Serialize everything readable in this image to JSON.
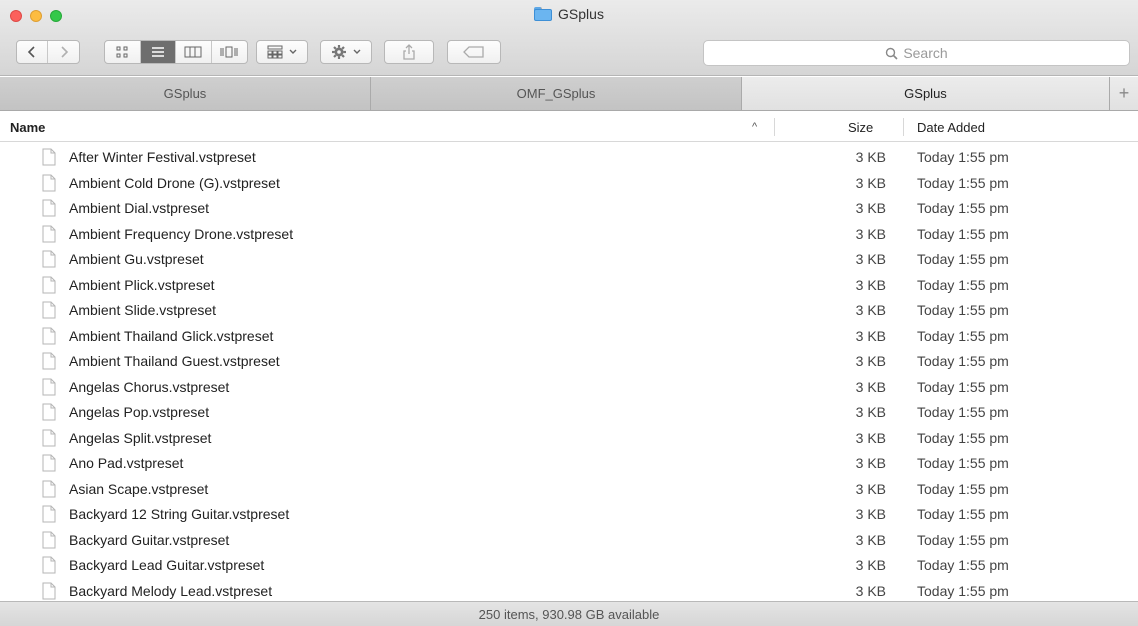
{
  "window": {
    "title": "GSplus"
  },
  "colors": {
    "accent": "#6e6e6e",
    "folder": "#6bb5f0"
  },
  "toolbar": {
    "back_icon": "chevron-left-icon",
    "forward_icon": "chevron-right-icon",
    "view_icons": [
      "icon-view-icon",
      "list-view-icon",
      "column-view-icon",
      "cover-flow-icon"
    ],
    "arrange_icon": "arrange-grid-icon",
    "action_icon": "gear-icon",
    "share_icon": "share-icon",
    "tags_icon": "tag-icon"
  },
  "search": {
    "placeholder": "Search"
  },
  "tabs": [
    {
      "label": "GSplus",
      "active": false
    },
    {
      "label": "OMF_GSplus",
      "active": false
    },
    {
      "label": "GSplus",
      "active": true
    }
  ],
  "columns": {
    "name": "Name",
    "size": "Size",
    "date_added": "Date Added",
    "sort_indicator": "^"
  },
  "files": [
    {
      "name": "After Winter Festival.vstpreset",
      "size": "3 KB",
      "date": "Today 1:55 pm"
    },
    {
      "name": "Ambient Cold Drone (G).vstpreset",
      "size": "3 KB",
      "date": "Today 1:55 pm"
    },
    {
      "name": "Ambient Dial.vstpreset",
      "size": "3 KB",
      "date": "Today 1:55 pm"
    },
    {
      "name": "Ambient Frequency Drone.vstpreset",
      "size": "3 KB",
      "date": "Today 1:55 pm"
    },
    {
      "name": "Ambient Gu.vstpreset",
      "size": "3 KB",
      "date": "Today 1:55 pm"
    },
    {
      "name": "Ambient Plick.vstpreset",
      "size": "3 KB",
      "date": "Today 1:55 pm"
    },
    {
      "name": "Ambient Slide.vstpreset",
      "size": "3 KB",
      "date": "Today 1:55 pm"
    },
    {
      "name": "Ambient Thailand Glick.vstpreset",
      "size": "3 KB",
      "date": "Today 1:55 pm"
    },
    {
      "name": "Ambient Thailand Guest.vstpreset",
      "size": "3 KB",
      "date": "Today 1:55 pm"
    },
    {
      "name": "Angelas Chorus.vstpreset",
      "size": "3 KB",
      "date": "Today 1:55 pm"
    },
    {
      "name": "Angelas Pop.vstpreset",
      "size": "3 KB",
      "date": "Today 1:55 pm"
    },
    {
      "name": "Angelas Split.vstpreset",
      "size": "3 KB",
      "date": "Today 1:55 pm"
    },
    {
      "name": "Ano Pad.vstpreset",
      "size": "3 KB",
      "date": "Today 1:55 pm"
    },
    {
      "name": "Asian Scape.vstpreset",
      "size": "3 KB",
      "date": "Today 1:55 pm"
    },
    {
      "name": "Backyard 12 String Guitar.vstpreset",
      "size": "3 KB",
      "date": "Today 1:55 pm"
    },
    {
      "name": "Backyard Guitar.vstpreset",
      "size": "3 KB",
      "date": "Today 1:55 pm"
    },
    {
      "name": "Backyard Lead Guitar.vstpreset",
      "size": "3 KB",
      "date": "Today 1:55 pm"
    },
    {
      "name": "Backyard Melody Lead.vstpreset",
      "size": "3 KB",
      "date": "Today 1:55 pm"
    }
  ],
  "status": {
    "text": "250 items, 930.98 GB available"
  }
}
